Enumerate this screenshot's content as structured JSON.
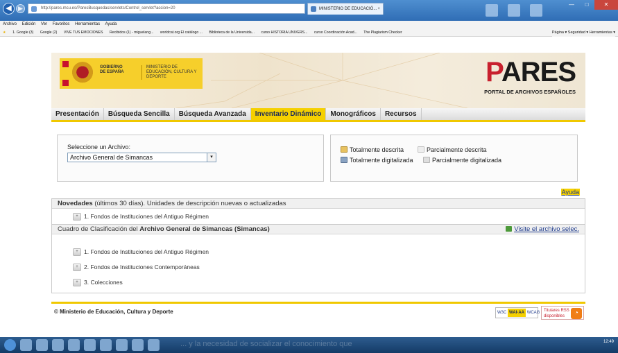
{
  "browser": {
    "url": "http://pares.mcu.es/ParesBusquedas/servlets/Control_servlet?accion=20",
    "address_tools": "⌕ ▾ C",
    "tab_title": "MINISTERIO DE EDUCACIÓ...",
    "tab_close": "×",
    "back": "◀",
    "forward": "▶",
    "win_min": "—",
    "win_max": "□",
    "win_close": "✕"
  },
  "menubar": {
    "items": [
      "Archivo",
      "Edición",
      "Ver",
      "Favoritos",
      "Herramientas",
      "Ayuda"
    ]
  },
  "favorites": {
    "star": "★",
    "items": [
      "1. Google (3)",
      "Google (2)",
      "VIVE TUS EMOCIONES",
      "Recibidos (1) - miguelang...",
      "worldcat.org El catálogo ...",
      "Biblioteca de la Universida...",
      "curso HISTORIA UNIVERS...",
      "curso Coordinación Acad...",
      "The Plagiarism Checker"
    ],
    "commands": "Página ▾  Seguridad ▾  Herramientas ▾"
  },
  "banner": {
    "gobierno": "GOBIERNO DE ESPAÑA",
    "ministerio": "MINISTERIO DE EDUCACIÓN, CULTURA Y DEPORTE",
    "pares_p": "P",
    "pares_rest": "ARES",
    "pares_sub": "PORTAL DE ARCHIVOS ESPAÑOLES"
  },
  "nav": {
    "tabs": [
      {
        "label": "Presentación",
        "active": false
      },
      {
        "label": "Búsqueda Sencilla",
        "active": false
      },
      {
        "label": "Búsqueda Avanzada",
        "active": false
      },
      {
        "label": "Inventario Dinámico",
        "active": true
      },
      {
        "label": "Monográficos",
        "active": false
      },
      {
        "label": "Recursos",
        "active": false
      }
    ]
  },
  "selector": {
    "label": "Seleccione un Archivo:",
    "value": "Archivo General de Simancas",
    "arrow": "▾"
  },
  "legend": {
    "full": "Totalmente descrita",
    "partial": "Parcialmente descrita",
    "digital": "Totalmente digitalizada",
    "partial_digital": "Parcialmente digitalizada"
  },
  "help": "Ayuda",
  "novedades": {
    "head_bold": "Novedades",
    "head_rest": " (últimos 30 días). Unidades de descripción nuevas o actualizadas",
    "items": [
      "1. Fondos de Instituciones del Antiguo Régimen"
    ]
  },
  "cuadro": {
    "head_a": "Cuadro de Clasificación del ",
    "head_b": "Archivo General de Simancas (Simancas)",
    "visit": "Visite el archivo selec.",
    "items": [
      "1. Fondos de Instituciones del Antiguo Régimen",
      "2. Fondos de Instituciones Contemporáneas",
      "3. Colecciones"
    ]
  },
  "footer": {
    "copyright": "© Ministerio de Educación, Cultura y Deporte",
    "w3c": "W3C",
    "wai": "WAI-AA",
    "wcag": "WCAG 1.0",
    "rss_a": "Titulares RSS",
    "rss_b": "disponibles"
  },
  "taskbar": {
    "ghost": "... y la necesidad de socializar el conocimiento que",
    "time": "12:49"
  },
  "toggle_glyph": "+",
  "colors": {
    "accent_yellow": "#f5d000",
    "link_blue": "#1f3b8c",
    "pares_red": "#c8202e"
  }
}
